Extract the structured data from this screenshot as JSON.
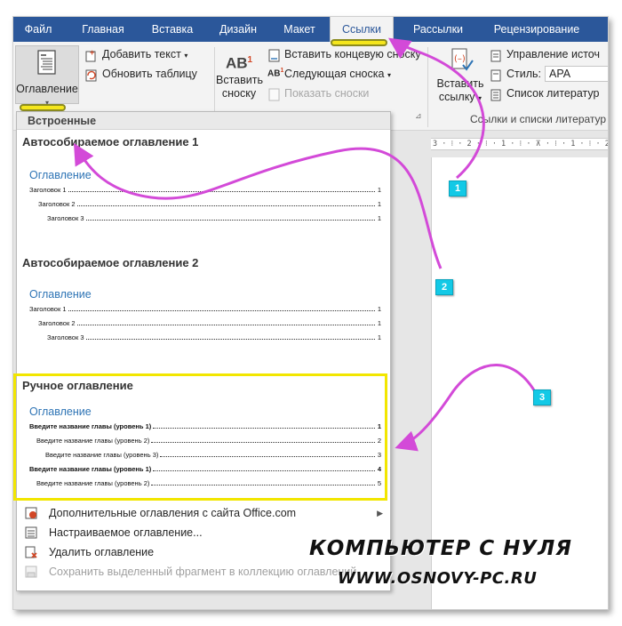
{
  "tabs": [
    {
      "label": "Файл",
      "active": false
    },
    {
      "label": "Главная",
      "active": false
    },
    {
      "label": "Вставка",
      "active": false
    },
    {
      "label": "Дизайн",
      "active": false
    },
    {
      "label": "Макет",
      "active": false
    },
    {
      "label": "Ссылки",
      "active": true
    },
    {
      "label": "Рассылки",
      "active": false
    },
    {
      "label": "Рецензирование",
      "active": false
    }
  ],
  "ribbon": {
    "toc_button": "Оглавление",
    "add_text": "Добавить текст",
    "update_table": "Обновить таблицу",
    "insert_footnote_line1": "Вставить",
    "insert_footnote_line2": "сноску",
    "footnote_icon_text": "AB",
    "footnote_sup": "1",
    "insert_endnote": "Вставить концевую сноску",
    "next_footnote": "Следующая сноска",
    "show_notes": "Показать сноски",
    "insert_citation_line1": "Вставить",
    "insert_citation_line2": "ссылку",
    "manage_sources": "Управление источ",
    "style_label": "Стиль:",
    "style_value": "APA",
    "bibliography": "Список литератур",
    "citations_group_label": "Ссылки и списки литератур",
    "launcher": "⊿"
  },
  "ruler_text": "3 · ⁝ · 2 · ⁝ · 1 · ⁝ · ⊼ · ⁝ · 1 · ⁝ · 2 ·",
  "gallery": {
    "header": "Встроенные",
    "auto1": {
      "title": "Автособираемое оглавление 1",
      "heading": "Оглавление",
      "lines": [
        {
          "text": "Заголовок 1",
          "page": "1"
        },
        {
          "text": "Заголовок 2",
          "page": "1"
        },
        {
          "text": "Заголовок 3",
          "page": "1"
        }
      ]
    },
    "auto2": {
      "title": "Автособираемое оглавление 2",
      "heading": "Оглавление",
      "lines": [
        {
          "text": "Заголовок 1",
          "page": "1"
        },
        {
          "text": "Заголовок 2",
          "page": "1"
        },
        {
          "text": "Заголовок 3",
          "page": "1"
        }
      ]
    },
    "manual": {
      "title": "Ручное оглавление",
      "heading": "Оглавление",
      "lines": [
        {
          "text": "Введите название главы (уровень 1)",
          "page": "1"
        },
        {
          "text": "Введите название главы (уровень 2)",
          "page": "2"
        },
        {
          "text": "Введите название главы (уровень 3)",
          "page": "3"
        },
        {
          "text": "Введите название главы (уровень 1)",
          "page": "4"
        },
        {
          "text": "Введите название главы (уровень 2)",
          "page": "5"
        }
      ]
    },
    "menu": [
      {
        "label": "Дополнительные оглавления с сайта Office.com",
        "disabled": false,
        "submenu": true
      },
      {
        "label": "Настраиваемое оглавление...",
        "disabled": false,
        "submenu": false
      },
      {
        "label": "Удалить оглавление",
        "disabled": false,
        "submenu": false
      },
      {
        "label": "Сохранить выделенный фрагмент в коллекцию оглавлений",
        "disabled": true,
        "submenu": false
      }
    ]
  },
  "annotations": {
    "badges": [
      "1",
      "2",
      "3"
    ],
    "marker_color": "#f5e61c",
    "arrow_color": "#d34ad8",
    "badge_color": "#13c9e6"
  },
  "watermark": {
    "line1": "КОМПЬЮТЕР С НУЛЯ",
    "line2": "WWW.OSNOVY-PC.RU"
  },
  "colors": {
    "ribbon_tab_bar": "#2b579a",
    "toc_heading": "#2e74b5",
    "highlight_box": "#f2e600"
  }
}
